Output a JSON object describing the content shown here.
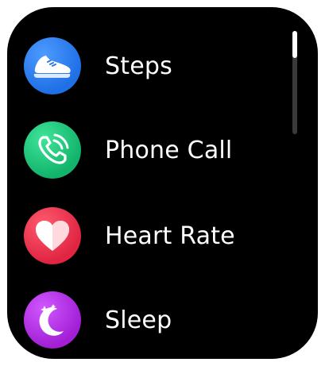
{
  "menu": {
    "items": [
      {
        "label": "Steps",
        "icon": "shoe-icon",
        "color": "#2e7ef0"
      },
      {
        "label": "Phone Call",
        "icon": "phone-icon",
        "color": "#20c97e"
      },
      {
        "label": "Heart Rate",
        "icon": "heart-icon",
        "color": "#f0364f"
      },
      {
        "label": "Sleep",
        "icon": "moon-icon",
        "color": "#b934e8"
      }
    ]
  },
  "scrollbar": {
    "position_fraction": 0.0,
    "visible_fraction": 0.26
  }
}
